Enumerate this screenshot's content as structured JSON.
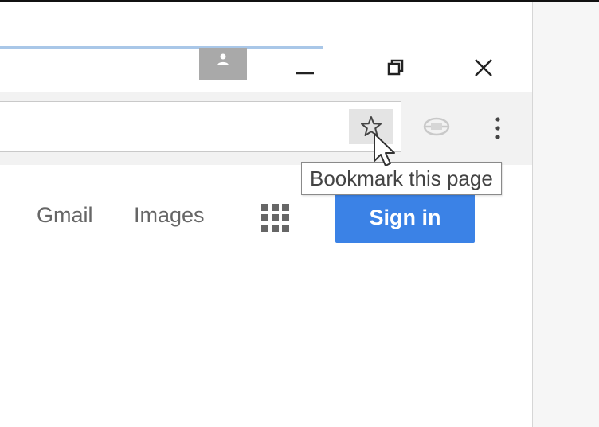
{
  "window": {
    "profile_icon": "person-icon",
    "minimize_icon": "minimize-icon",
    "restore_icon": "restore-icon",
    "close_icon": "close-icon"
  },
  "toolbar": {
    "bookmark_icon": "star-icon",
    "extension_icon": "extension-icon",
    "menu_icon": "more-vertical-icon"
  },
  "tooltip": {
    "text": "Bookmark this page"
  },
  "google_header": {
    "gmail_label": "Gmail",
    "images_label": "Images",
    "apps_icon": "apps-grid-icon",
    "sign_in_label": "Sign in"
  },
  "colors": {
    "sign_in_bg": "#3b82e6",
    "tab_indicator": "#a9c7e8",
    "profile_bg": "#a9a9a9"
  }
}
